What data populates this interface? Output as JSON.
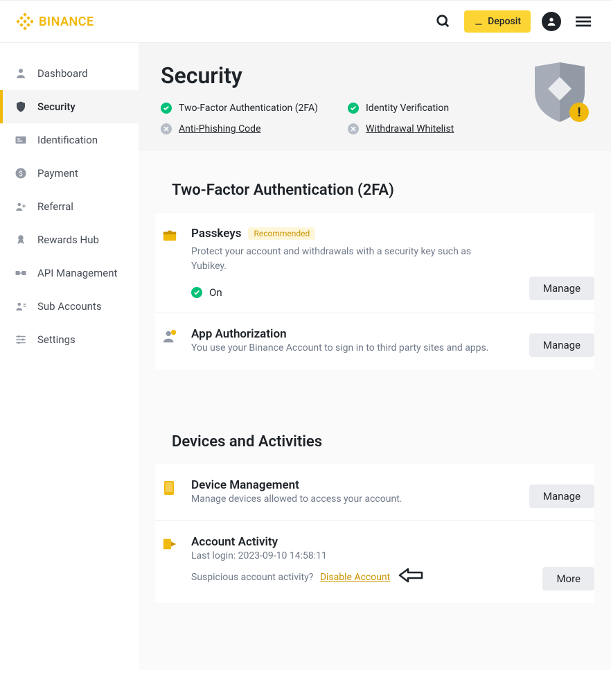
{
  "header": {
    "brand": "BINANCE",
    "deposit_label": "Deposit"
  },
  "sidebar": {
    "items": [
      {
        "label": "Dashboard",
        "key": "dashboard"
      },
      {
        "label": "Security",
        "key": "security"
      },
      {
        "label": "Identification",
        "key": "identification"
      },
      {
        "label": "Payment",
        "key": "payment"
      },
      {
        "label": "Referral",
        "key": "referral"
      },
      {
        "label": "Rewards Hub",
        "key": "rewards-hub"
      },
      {
        "label": "API Management",
        "key": "api-management"
      },
      {
        "label": "Sub Accounts",
        "key": "sub-accounts"
      },
      {
        "label": "Settings",
        "key": "settings"
      }
    ]
  },
  "page": {
    "title": "Security",
    "status": {
      "twofa": "Two-Factor Authentication (2FA)",
      "identity": "Identity Verification",
      "antiphishing": "Anti-Phishing Code",
      "withdrawal": "Withdrawal Whitelist"
    }
  },
  "sections": {
    "twofa": {
      "title": "Two-Factor Authentication (2FA)",
      "passkeys": {
        "title": "Passkeys",
        "badge": "Recommended",
        "desc": "Protect your account and withdrawals with a security key such as Yubikey.",
        "status": "On",
        "button": "Manage"
      },
      "appauth": {
        "title": "App Authorization",
        "desc": "You use your Binance Account to sign in to third party sites and apps.",
        "button": "Manage"
      }
    },
    "devices": {
      "title": "Devices and Activities",
      "device_mgmt": {
        "title": "Device Management",
        "desc": "Manage devices allowed to access your account.",
        "button": "Manage"
      },
      "activity": {
        "title": "Account Activity",
        "last_login": "Last login: 2023-09-10 14:58:11",
        "suspicious": "Suspicious account activity?",
        "disable_link": "Disable Account",
        "button": "More"
      }
    }
  }
}
